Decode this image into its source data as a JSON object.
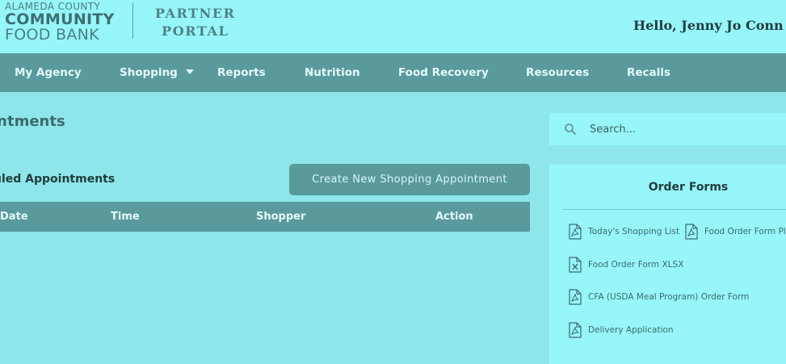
{
  "header": {
    "logo": {
      "line1": "ALAMEDA COUNTY",
      "line2": "COMMUNITY",
      "line3": "FOOD BANK"
    },
    "portal": {
      "line1": "PARTNER",
      "line2": "PORTAL"
    },
    "greeting": "Hello, Jenny Jo Conn"
  },
  "nav": {
    "items": [
      "My Agency",
      "Shopping",
      "Reports",
      "Nutrition",
      "Food Recovery",
      "Resources",
      "Recalls"
    ]
  },
  "main": {
    "page_title": "intments",
    "section_title": "uled Appointments",
    "create_button": "Create New Shopping Appointment",
    "table": {
      "headers": [
        "Date",
        "Time",
        "Shopper",
        "Action"
      ],
      "rows": []
    }
  },
  "sidebar": {
    "search": {
      "placeholder": "Search...",
      "icon": "search-icon"
    },
    "order_forms": {
      "title": "Order Forms",
      "links": [
        {
          "label": "Today's Shopping List",
          "icon": "pdf-file-icon"
        },
        {
          "label": "Food Order Form Pl",
          "icon": "pdf-file-icon"
        },
        {
          "label": "Food Order Form XLSX",
          "icon": "excel-file-icon"
        },
        {
          "label": "CFA (USDA Meal Program) Order Form",
          "icon": "pdf-file-icon"
        },
        {
          "label": "Delivery Application",
          "icon": "pdf-file-icon"
        }
      ]
    }
  },
  "colors": {
    "background": "#8ee6ea",
    "header_background": "#96f6fa",
    "nav_background": "#5a9a9d",
    "button_background": "#5a9a9d"
  }
}
